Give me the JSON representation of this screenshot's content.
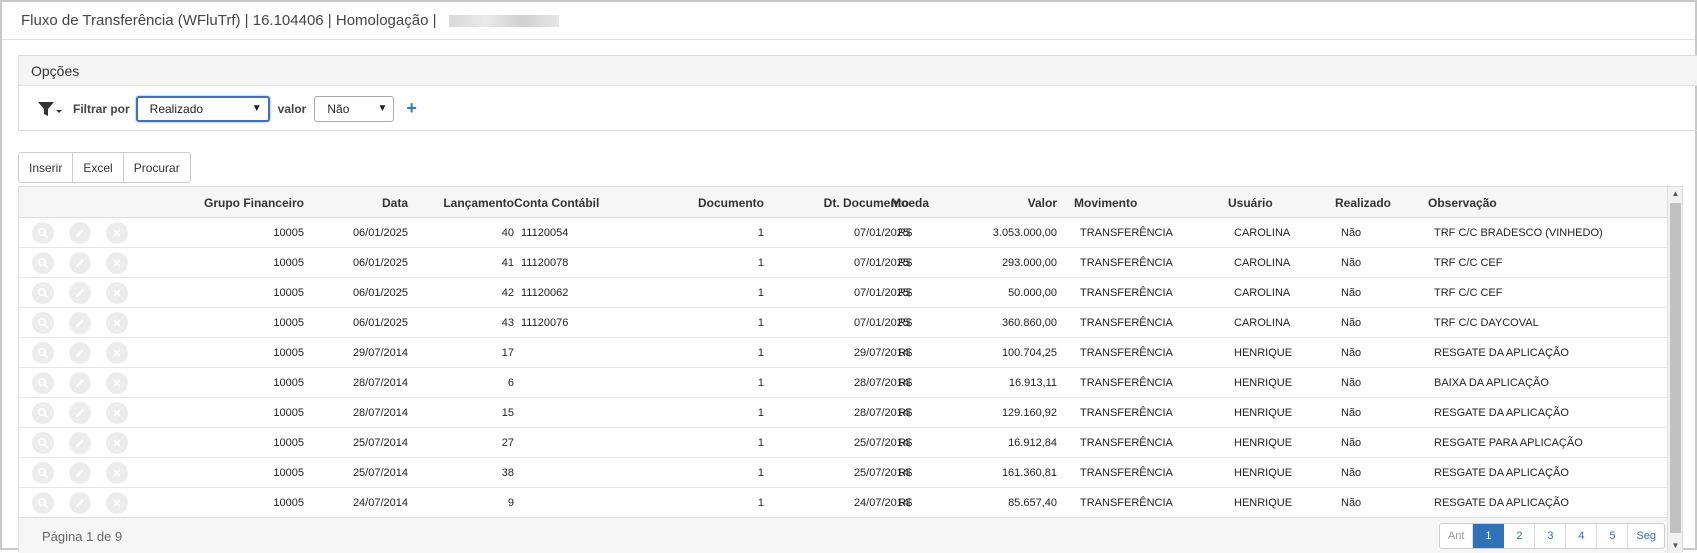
{
  "window": {
    "title": "Fluxo de Transferência (WFluTrf) | 16.104406 | Homologação |"
  },
  "options": {
    "header": "Opções",
    "filter_icon": "filter-icon",
    "filter_label": "Filtrar por",
    "filter_select": "Realizado",
    "value_label": "valor",
    "value_select": "Não",
    "add_icon": "+"
  },
  "toolbar": {
    "insert": "Inserir",
    "excel": "Excel",
    "search": "Procurar"
  },
  "table": {
    "columns": {
      "grupo": "Grupo Financeiro",
      "data": "Data",
      "lancamento": "Lançamento",
      "conta": "Conta Contábil",
      "documento": "Documento",
      "dtdoc": "Dt. Documento",
      "moeda": "Moeda",
      "valor": "Valor",
      "movimento": "Movimento",
      "usuario": "Usuário",
      "realizado": "Realizado",
      "obs": "Observação"
    },
    "rows": [
      {
        "grupo": "10005",
        "data": "06/01/2025",
        "lancamento": "40",
        "conta": "11120054",
        "documento": "1",
        "dtdoc": "07/01/2025",
        "moeda": "R$",
        "valor": "3.053.000,00",
        "movimento": "TRANSFERÊNCIA",
        "usuario": "CAROLINA",
        "realizado": "Não",
        "obs": "TRF C/C BRADESCO (VINHEDO)"
      },
      {
        "grupo": "10005",
        "data": "06/01/2025",
        "lancamento": "41",
        "conta": "11120078",
        "documento": "1",
        "dtdoc": "07/01/2025",
        "moeda": "R$",
        "valor": "293.000,00",
        "movimento": "TRANSFERÊNCIA",
        "usuario": "CAROLINA",
        "realizado": "Não",
        "obs": "TRF C/C CEF"
      },
      {
        "grupo": "10005",
        "data": "06/01/2025",
        "lancamento": "42",
        "conta": "11120062",
        "documento": "1",
        "dtdoc": "07/01/2025",
        "moeda": "R$",
        "valor": "50.000,00",
        "movimento": "TRANSFERÊNCIA",
        "usuario": "CAROLINA",
        "realizado": "Não",
        "obs": "TRF C/C CEF"
      },
      {
        "grupo": "10005",
        "data": "06/01/2025",
        "lancamento": "43",
        "conta": "11120076",
        "documento": "1",
        "dtdoc": "07/01/2025",
        "moeda": "R$",
        "valor": "360.860,00",
        "movimento": "TRANSFERÊNCIA",
        "usuario": "CAROLINA",
        "realizado": "Não",
        "obs": "TRF C/C DAYCOVAL"
      },
      {
        "grupo": "10005",
        "data": "29/07/2014",
        "lancamento": "17",
        "conta": "",
        "documento": "1",
        "dtdoc": "29/07/2014",
        "moeda": "R$",
        "valor": "100.704,25",
        "movimento": "TRANSFERÊNCIA",
        "usuario": "HENRIQUE",
        "realizado": "Não",
        "obs": "RESGATE DA APLICAÇÃO"
      },
      {
        "grupo": "10005",
        "data": "28/07/2014",
        "lancamento": "6",
        "conta": "",
        "documento": "1",
        "dtdoc": "28/07/2014",
        "moeda": "R$",
        "valor": "16.913,11",
        "movimento": "TRANSFERÊNCIA",
        "usuario": "HENRIQUE",
        "realizado": "Não",
        "obs": "BAIXA DA APLICAÇÃO"
      },
      {
        "grupo": "10005",
        "data": "28/07/2014",
        "lancamento": "15",
        "conta": "",
        "documento": "1",
        "dtdoc": "28/07/2014",
        "moeda": "R$",
        "valor": "129.160,92",
        "movimento": "TRANSFERÊNCIA",
        "usuario": "HENRIQUE",
        "realizado": "Não",
        "obs": "RESGATE DA APLICAÇÃO"
      },
      {
        "grupo": "10005",
        "data": "25/07/2014",
        "lancamento": "27",
        "conta": "",
        "documento": "1",
        "dtdoc": "25/07/2014",
        "moeda": "R$",
        "valor": "16.912,84",
        "movimento": "TRANSFERÊNCIA",
        "usuario": "HENRIQUE",
        "realizado": "Não",
        "obs": "RESGATE PARA APLICAÇÃO"
      },
      {
        "grupo": "10005",
        "data": "25/07/2014",
        "lancamento": "38",
        "conta": "",
        "documento": "1",
        "dtdoc": "25/07/2014",
        "moeda": "R$",
        "valor": "161.360,81",
        "movimento": "TRANSFERÊNCIA",
        "usuario": "HENRIQUE",
        "realizado": "Não",
        "obs": "RESGATE DA APLICAÇÃO"
      },
      {
        "grupo": "10005",
        "data": "24/07/2014",
        "lancamento": "9",
        "conta": "",
        "documento": "1",
        "dtdoc": "24/07/2014",
        "moeda": "R$",
        "valor": "85.657,40",
        "movimento": "TRANSFERÊNCIA",
        "usuario": "HENRIQUE",
        "realizado": "Não",
        "obs": "RESGATE DA APLICAÇÃO"
      }
    ],
    "row_actions": [
      "search-icon",
      "edit-icon",
      "delete-icon"
    ]
  },
  "pagination": {
    "info": "Página 1 de 9",
    "prev": "Ant",
    "pages": [
      "1",
      "2",
      "3",
      "4",
      "5"
    ],
    "active_page": "1",
    "next": "Seg"
  },
  "colors": {
    "accent": "#2f72b8",
    "border": "#dcdcdc",
    "header_bg": "#f6f6f6"
  }
}
